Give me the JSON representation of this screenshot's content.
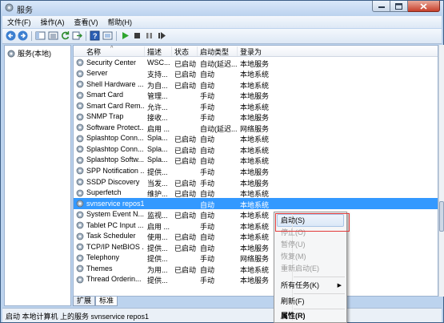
{
  "window": {
    "title": "服务"
  },
  "menu": [
    "文件(F)",
    "操作(A)",
    "查看(V)",
    "帮助(H)"
  ],
  "toolbar_icons": [
    "back-icon",
    "forward-icon",
    "console-tree-icon",
    "properties-list-icon",
    "refresh-icon",
    "export-icon",
    "help-icon",
    "view-icon",
    "start-service-icon",
    "stop-service-icon",
    "pause-service-icon",
    "restart-service-icon"
  ],
  "tree": {
    "root_label": "服务(本地)"
  },
  "columns": {
    "name": "名称",
    "desc": "描述",
    "status": "状态",
    "startup": "启动类型",
    "logon": "登录为"
  },
  "services": [
    {
      "name": "Security Center",
      "desc": "WSC...",
      "status": "已启动",
      "startup": "自动(延迟...",
      "logon": "本地服务"
    },
    {
      "name": "Server",
      "desc": "支持...",
      "status": "已启动",
      "startup": "自动",
      "logon": "本地系统"
    },
    {
      "name": "Shell Hardware ...",
      "desc": "为自...",
      "status": "已启动",
      "startup": "自动",
      "logon": "本地系统"
    },
    {
      "name": "Smart Card",
      "desc": "管理...",
      "status": "",
      "startup": "手动",
      "logon": "本地服务"
    },
    {
      "name": "Smart Card Rem...",
      "desc": "允许...",
      "status": "",
      "startup": "手动",
      "logon": "本地系统"
    },
    {
      "name": "SNMP Trap",
      "desc": "接收...",
      "status": "",
      "startup": "手动",
      "logon": "本地服务"
    },
    {
      "name": "Software Protect...",
      "desc": "启用 ...",
      "status": "",
      "startup": "自动(延迟...",
      "logon": "网络服务"
    },
    {
      "name": "Splashtop Conn...",
      "desc": "Spla...",
      "status": "已启动",
      "startup": "自动",
      "logon": "本地系统"
    },
    {
      "name": "Splashtop Conn...",
      "desc": "Spla...",
      "status": "已启动",
      "startup": "自动",
      "logon": "本地系统"
    },
    {
      "name": "Splashtop Softw...",
      "desc": "Spla...",
      "status": "已启动",
      "startup": "自动",
      "logon": "本地系统"
    },
    {
      "name": "SPP Notification ...",
      "desc": "提供...",
      "status": "",
      "startup": "手动",
      "logon": "本地服务"
    },
    {
      "name": "SSDP Discovery",
      "desc": "当发...",
      "status": "已启动",
      "startup": "手动",
      "logon": "本地服务"
    },
    {
      "name": "Superfetch",
      "desc": "维护...",
      "status": "已启动",
      "startup": "自动",
      "logon": "本地系统"
    },
    {
      "name": "svnservice repos1",
      "desc": "",
      "status": "",
      "startup": "自动",
      "logon": "本地系统"
    },
    {
      "name": "System Event N...",
      "desc": "监视...",
      "status": "已启动",
      "startup": "自动",
      "logon": "本地系统"
    },
    {
      "name": "Tablet PC Input ...",
      "desc": "启用 ...",
      "status": "",
      "startup": "手动",
      "logon": "本地系统"
    },
    {
      "name": "Task Scheduler",
      "desc": "使用...",
      "status": "已启动",
      "startup": "自动",
      "logon": "本地系统"
    },
    {
      "name": "TCP/IP NetBIOS ...",
      "desc": "提供...",
      "status": "已启动",
      "startup": "自动",
      "logon": "本地服务"
    },
    {
      "name": "Telephony",
      "desc": "提供...",
      "status": "",
      "startup": "手动",
      "logon": "网络服务"
    },
    {
      "name": "Themes",
      "desc": "为用...",
      "status": "已启动",
      "startup": "自动",
      "logon": "本地系统"
    },
    {
      "name": "Thread Orderin...",
      "desc": "提供...",
      "status": "",
      "startup": "手动",
      "logon": "本地服务"
    }
  ],
  "selected_service": "svnservice repos1",
  "tabs": [
    "扩展",
    "标准"
  ],
  "status_bar": "启动 本地计算机 上的服务 svnservice repos1",
  "context_menu": [
    {
      "label": "启动(S)",
      "enabled": true
    },
    {
      "label": "停止(O)",
      "enabled": false
    },
    {
      "label": "暂停(U)",
      "enabled": false
    },
    {
      "label": "恢复(M)",
      "enabled": false
    },
    {
      "label": "重新启动(E)",
      "enabled": false
    },
    {
      "label": "所有任务(K)",
      "enabled": true
    },
    {
      "label": "刷新(F)",
      "enabled": true
    },
    {
      "label": "属性(R)",
      "enabled": true
    }
  ],
  "colors": {
    "selection": "#3399ff",
    "highlight_box": "#e23a3a",
    "title_gradient_top": "#d9e8f9"
  }
}
